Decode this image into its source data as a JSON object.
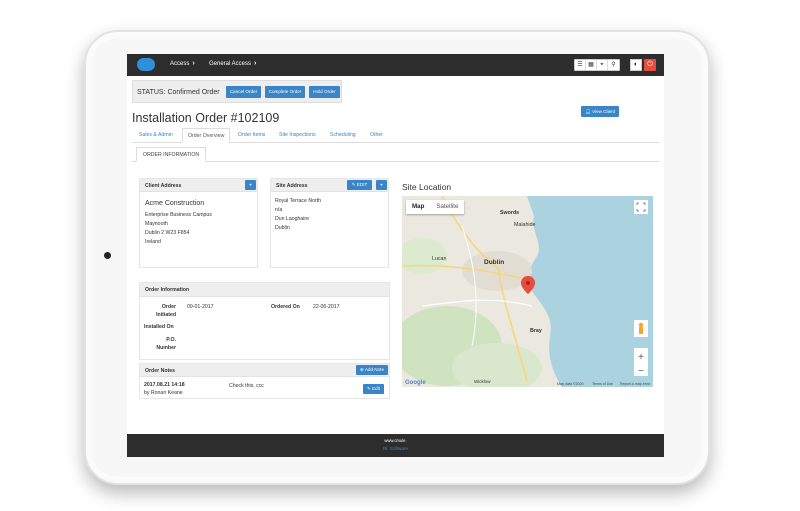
{
  "header": {
    "breadcrumb": [
      "Access",
      "General Access"
    ],
    "tool_icons": [
      "list-icon",
      "grid-icon",
      "pin-icon",
      "search-icon",
      "contrast-icon",
      "power-icon"
    ]
  },
  "status": {
    "label": "STATUS: Confirmed Order",
    "buttons": [
      "Cancel Order",
      "Complete Order",
      "Hold Order"
    ]
  },
  "page": {
    "title": "Installation Order #102109",
    "view_client": "View Client"
  },
  "tabs": [
    "Sales & Admin",
    "Order Overview",
    "Order Items",
    "Site Inspections",
    "Scheduling",
    "Other"
  ],
  "subtab": "ORDER INFORMATION",
  "client_address": {
    "title": "Client Address",
    "company": "Acme Construction",
    "lines": [
      "Enterprise Business Campus",
      "Maynooth",
      "Dublin 2 W23 F854",
      "Ireland"
    ]
  },
  "site_address": {
    "title": "Site Address",
    "edit_label": "EDIT",
    "lines": [
      "Royal Terrace North",
      "n/a",
      "Dun Laoghaire",
      "Dublin"
    ]
  },
  "order_information": {
    "title": "Order Information",
    "initiated_label": "Order Initiated",
    "initiated_value": "09-01-2017",
    "ordered_on_label": "Ordered On",
    "ordered_on_value": "22-06-2017",
    "installed_on_label": "Installed On",
    "po_label": "P.O. Number"
  },
  "order_notes": {
    "title": "Order Notes",
    "add_label": "Add Note",
    "note": {
      "date": "2017.08.21 14:18",
      "author": "by Ronan Keane",
      "text": "Check this, ccc",
      "edit_label": "Edit"
    }
  },
  "map": {
    "title": "Site Location",
    "buttons": [
      "Map",
      "Satellite"
    ],
    "places": [
      "Swords",
      "Dublin",
      "Bray",
      "Lucan",
      "Malahide",
      "Wicklow"
    ],
    "footer": [
      "Google",
      "Map data ©2020",
      "Terms of Use",
      "Report a map error"
    ]
  },
  "footer": {
    "line1": "www.cmule.",
    "line2": "Rl. Software"
  }
}
